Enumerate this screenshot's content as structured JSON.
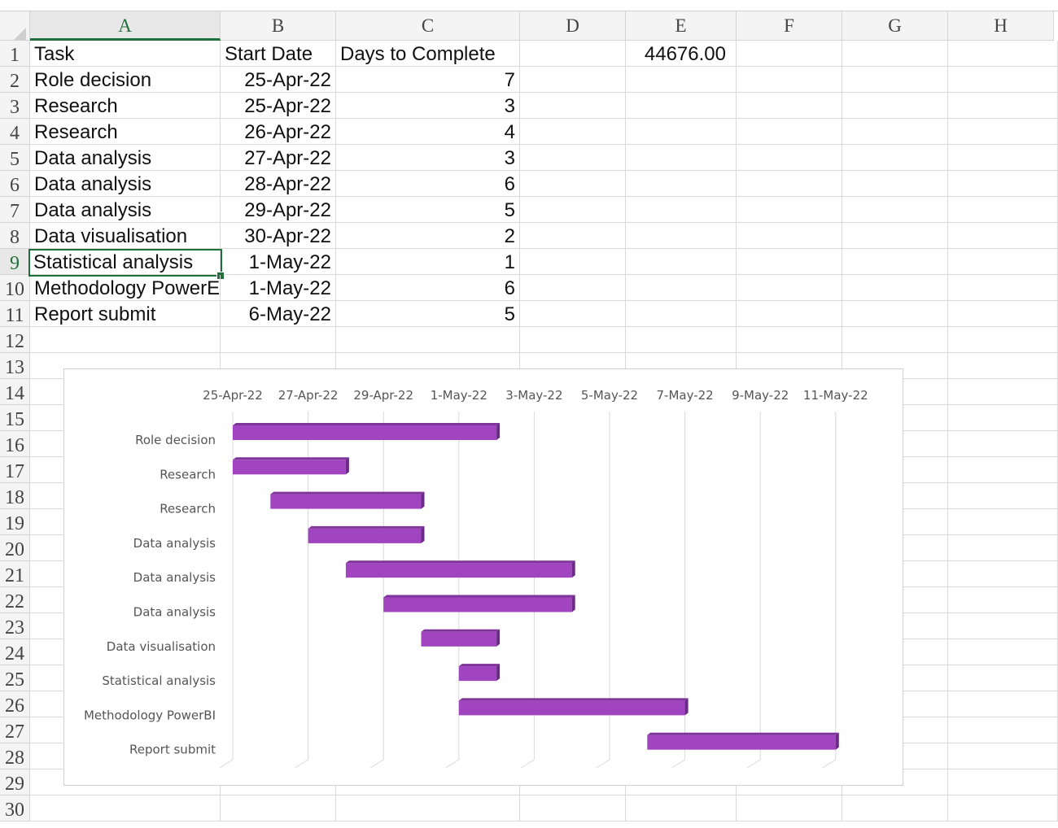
{
  "columns": [
    "A",
    "B",
    "C",
    "D",
    "E",
    "F",
    "G",
    "H"
  ],
  "rows": [
    "1",
    "2",
    "3",
    "4",
    "5",
    "6",
    "7",
    "8",
    "9",
    "10",
    "11",
    "12",
    "13",
    "14",
    "15",
    "16",
    "17",
    "18",
    "19",
    "20",
    "21",
    "22",
    "23",
    "24",
    "25",
    "26",
    "27",
    "28",
    "29",
    "30"
  ],
  "sheet": {
    "header": {
      "task": "Task",
      "start": "Start Date",
      "days": "Days to Complete",
      "e1": "44676.00"
    },
    "tasks": [
      {
        "task": "Role decision",
        "start": "25-Apr-22",
        "days": "7"
      },
      {
        "task": "Research",
        "start": "25-Apr-22",
        "days": "3"
      },
      {
        "task": "Research",
        "start": "26-Apr-22",
        "days": "4"
      },
      {
        "task": "Data analysis",
        "start": "27-Apr-22",
        "days": "3"
      },
      {
        "task": "Data analysis",
        "start": "28-Apr-22",
        "days": "6"
      },
      {
        "task": "Data analysis",
        "start": "29-Apr-22",
        "days": "5"
      },
      {
        "task": "Data visualisation",
        "start": "30-Apr-22",
        "days": "2"
      },
      {
        "task": "Statistical analysis",
        "start": "1-May-22",
        "days": "1"
      },
      {
        "task": "Methodology PowerE",
        "start": "1-May-22",
        "days": "6"
      },
      {
        "task": "Report submit",
        "start": "6-May-22",
        "days": "5"
      }
    ],
    "selected_cell": "A9"
  },
  "chart_data": {
    "type": "bar",
    "orientation": "horizontal-gantt",
    "categories": [
      "Role decision",
      "Research",
      "Research",
      "Data analysis",
      "Data analysis",
      "Data analysis",
      "Data visualisation",
      "Statistical analysis",
      "Methodology PowerBI",
      "Report submit"
    ],
    "start_dates": [
      "2022-04-25",
      "2022-04-25",
      "2022-04-26",
      "2022-04-27",
      "2022-04-28",
      "2022-04-29",
      "2022-04-30",
      "2022-05-01",
      "2022-05-01",
      "2022-05-06"
    ],
    "durations_days": [
      7,
      3,
      4,
      3,
      6,
      5,
      2,
      1,
      6,
      5
    ],
    "x_ticks": [
      "25-Apr-22",
      "27-Apr-22",
      "29-Apr-22",
      "1-May-22",
      "3-May-22",
      "5-May-22",
      "7-May-22",
      "9-May-22",
      "11-May-22"
    ],
    "xlim": [
      "2022-04-25",
      "2022-05-11"
    ],
    "grid": true,
    "bar_color": "#a044c0",
    "bar_edge_color": "#6a2a86",
    "title": "",
    "xlabel": "",
    "ylabel": ""
  }
}
